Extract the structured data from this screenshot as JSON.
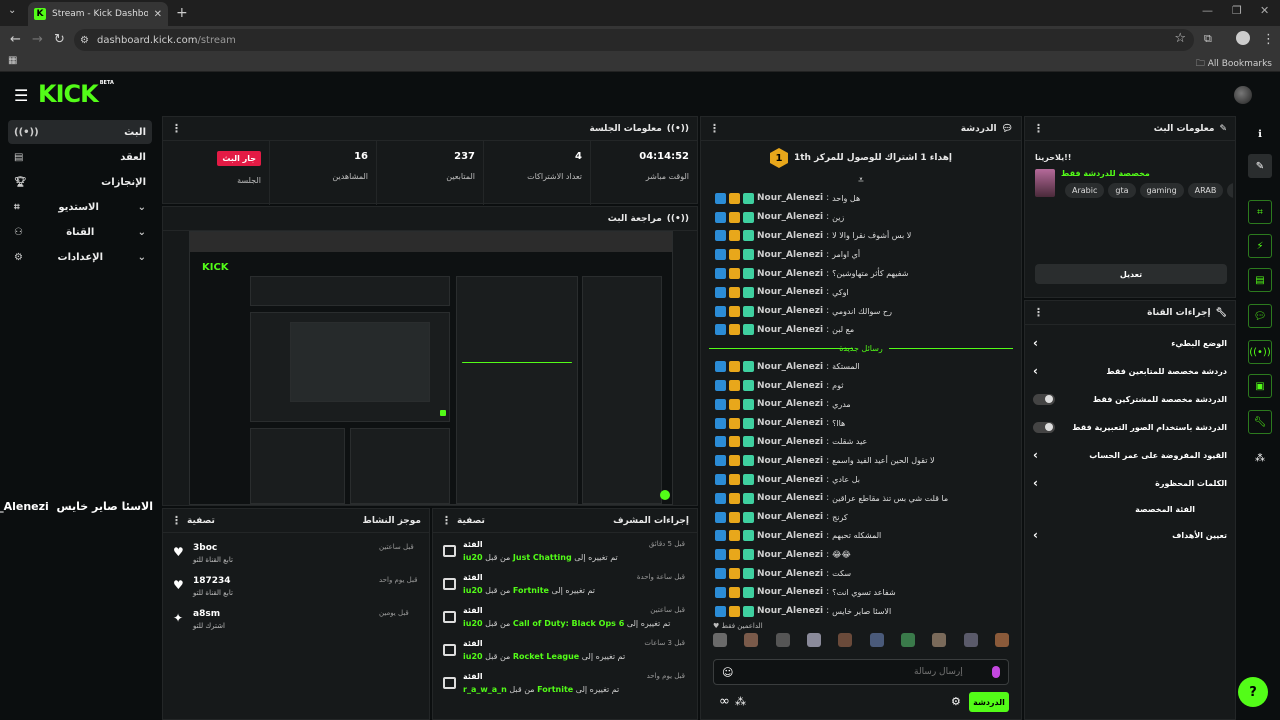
{
  "browser": {
    "tab_title": "Stream - Kick Dashboard",
    "url_host": "dashboard.kick.com",
    "url_path": "/stream",
    "bookmarks_label": "All Bookmarks"
  },
  "brand": {
    "logo": "KICK",
    "beta": "BETA",
    "accent": "#53fc18"
  },
  "sidebar": {
    "items": [
      {
        "label": "البث",
        "icon": "broadcast-icon"
      },
      {
        "label": "العقد",
        "icon": "contract-icon"
      },
      {
        "label": "الإنجازات",
        "icon": "trophy-icon"
      },
      {
        "label": "الاستديو",
        "icon": "studio-icon"
      },
      {
        "label": "القناة",
        "icon": "channel-icon"
      },
      {
        "label": "الإعدادات",
        "icon": "gear-icon"
      }
    ]
  },
  "session": {
    "title": "معلومات الجلسة",
    "stats": [
      {
        "value": "04:14:52",
        "label": "الوقت مباشر"
      },
      {
        "value": "4",
        "label": "تعداد الاشتراكات"
      },
      {
        "value": "237",
        "label": "المتابعين"
      },
      {
        "value": "16",
        "label": "المشاهدين"
      },
      {
        "value": "جار البث",
        "label": "الجلسة"
      }
    ]
  },
  "preview": {
    "title": "مراجعة البث"
  },
  "hover_user": {
    "name": "Nour_Alenezi",
    "text": "الاسئا صاير خايس"
  },
  "activity": {
    "title": "موجز النشاط",
    "filter": "تصفية",
    "items": [
      {
        "who": "3boc",
        "what": "تابع القناة للتو",
        "time": "قبل ساعتين"
      },
      {
        "who": "187234",
        "what": "تابع القناة للتو",
        "time": "قبل يوم واحد"
      },
      {
        "who": "a8sm",
        "what": "اشترك للتو",
        "time": "قبل يومين"
      }
    ]
  },
  "mod": {
    "title": "إجراءات المشرف",
    "filter": "تصفية",
    "items": [
      {
        "tag": "الفئة",
        "cat": "Just Chatting",
        "by": "iu20",
        "time": "قبل 5 دقائق"
      },
      {
        "tag": "الفئة",
        "cat": "Fortnite",
        "by": "iu20",
        "time": "قبل ساعة واحدة"
      },
      {
        "tag": "الفئة",
        "cat": "Call of Duty: Black Ops 6",
        "by": "iu20",
        "time": "قبل ساعتين"
      },
      {
        "tag": "الفئة",
        "cat": "Rocket League",
        "by": "iu20",
        "time": "قبل 3 ساعات"
      },
      {
        "tag": "الفئة",
        "cat": "Fortnite",
        "by": "r_a_w_a_n",
        "time": "قبل يوم واحد"
      }
    ],
    "changed_to": "تم تغييره إلى",
    "from_by": "من قبل"
  },
  "chat": {
    "title": "الدردشة",
    "goal": "إهداء 1 اشتراك للوصول للمركز 1",
    "goal_rank": "1",
    "goal_suffix": "th",
    "new_messages": "رسائل جديدة",
    "messages_before": [
      {
        "user": "Nour_Alenezi",
        "text": "هل واحد"
      },
      {
        "user": "Nour_Alenezi",
        "text": "زين"
      },
      {
        "user": "Nour_Alenezi",
        "text": "لا بس أشوف نقرا والا لا"
      },
      {
        "user": "Nour_Alenezi",
        "text": "أي اوامر"
      },
      {
        "user": "Nour_Alenezi",
        "text": "شفيهم كأثر متهاوشين؟"
      },
      {
        "user": "Nour_Alenezi",
        "text": "اوكي"
      },
      {
        "user": "Nour_Alenezi",
        "text": "رح سوالك اندومي"
      },
      {
        "user": "Nour_Alenezi",
        "text": "مع لبن"
      }
    ],
    "messages_after": [
      {
        "user": "Nour_Alenezi",
        "text": "المستكة"
      },
      {
        "user": "Nour_Alenezi",
        "text": "ثوم"
      },
      {
        "user": "Nour_Alenezi",
        "text": "مدري"
      },
      {
        "user": "Nour_Alenezi",
        "text": "هاا؟"
      },
      {
        "user": "Nour_Alenezi",
        "text": "عيد شقلت"
      },
      {
        "user": "Nour_Alenezi",
        "text": "لا تقول الحين أعيد الفيد واسمع"
      },
      {
        "user": "Nour_Alenezi",
        "text": "بل عادي"
      },
      {
        "user": "Nour_Alenezi",
        "text": "ما قلت شي بس تنذ مقاطع عراقين"
      },
      {
        "user": "Nour_Alenezi",
        "text": "كرنج"
      },
      {
        "user": "Nour_Alenezi",
        "text": "المشكله تحبهم"
      },
      {
        "user": "Nour_Alenezi",
        "text": "😂😂"
      },
      {
        "user": "Nour_Alenezi",
        "text": "سكت"
      },
      {
        "user": "Nour_Alenezi",
        "text": "شفاعد تسوي انت؟"
      },
      {
        "user": "Nour_Alenezi",
        "text": "الاسئا صاير خايس"
      }
    ],
    "supporters": "الداعمين فقط",
    "placeholder": "إرسال رسالة",
    "send": "الدردشة"
  },
  "stream_info": {
    "title": "معلومات البث",
    "greeting": "يلاحرينا!!",
    "category": "مخصصة للدردشة فقط",
    "tags": [
      "Arabic",
      "gta",
      "gaming",
      "ARAB",
      "funny"
    ],
    "edit": "تعديل"
  },
  "channel_actions": {
    "title": "إجراءات القناة",
    "rows": [
      {
        "label": "الوضع البطيء",
        "kind": "chevron"
      },
      {
        "label": "دردشة مخصصة للمتابعين فقط",
        "kind": "chevron"
      },
      {
        "label": "الدردشة مخصصة للمشتركين فقط",
        "kind": "toggle"
      },
      {
        "label": "الدردشة باستخدام الصور التعبيرية فقط",
        "kind": "toggle"
      },
      {
        "label": "القيود المفروضة على عمر الحساب",
        "kind": "chevron"
      },
      {
        "label": "الكلمات المحظورة",
        "kind": "chevron"
      },
      {
        "label": "الفئة المخصصة",
        "kind": "none"
      },
      {
        "label": "تعيين الأهداف",
        "kind": "chevron"
      }
    ]
  }
}
